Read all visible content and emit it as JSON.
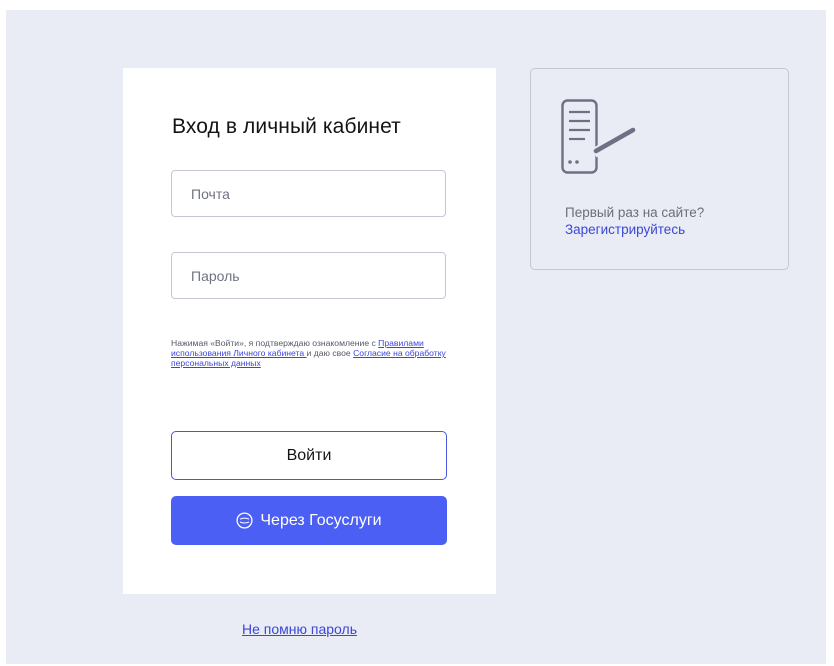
{
  "login": {
    "title": "Вход в личный кабинет",
    "email_placeholder": "Почта",
    "password_placeholder": "Пароль",
    "consent": {
      "prefix": "Нажимая «Войти», я подтверждаю ознакомление с",
      "rules_link": "Правилами использования Личного кабинета ",
      "middle": "и даю свое",
      "agreement_link": "Согласие на обработку персональных данных"
    },
    "login_button": "Войти",
    "gosuslugi_button": "Через Госуслуги",
    "gosuslugi_icon": "gosuslugi-logo-icon"
  },
  "register": {
    "icon": "document-edit-icon",
    "question": "Первый раз на сайте?",
    "link": "Зарегистрируйтесь"
  },
  "forgot_password": "Не помню пароль",
  "colors": {
    "background": "#e9ecf4",
    "accent": "#4b5ff5",
    "link": "#3b47d8",
    "border": "#c5c8d3"
  }
}
